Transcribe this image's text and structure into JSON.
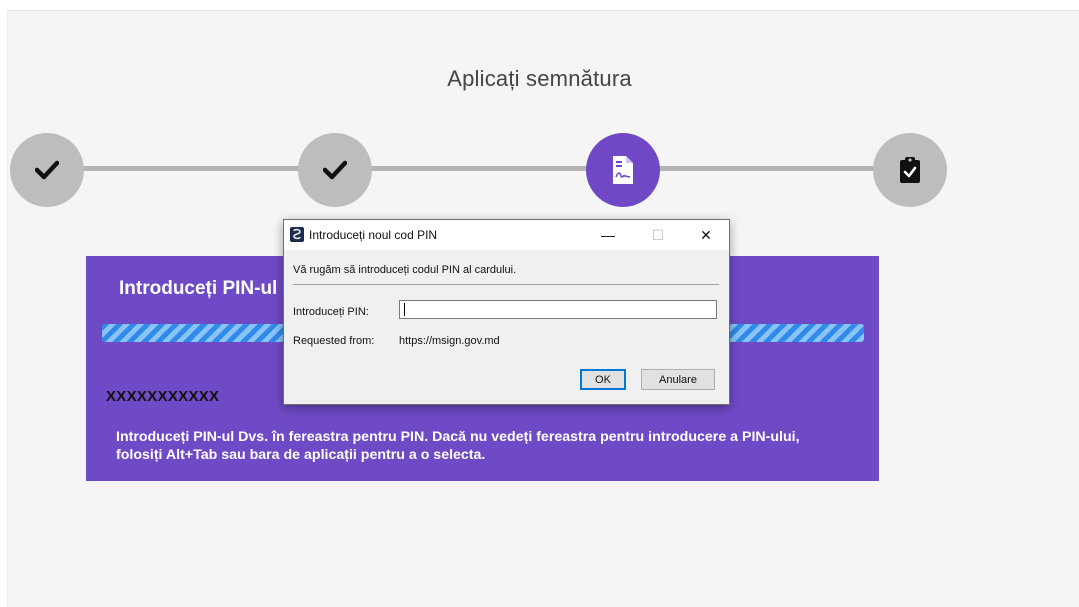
{
  "page": {
    "title": "Aplicați semnătura"
  },
  "stepper": {
    "steps": [
      {
        "state": "completed",
        "icon": "check-icon"
      },
      {
        "state": "completed",
        "icon": "check-icon"
      },
      {
        "state": "active",
        "icon": "signed-document-icon"
      },
      {
        "state": "pending",
        "icon": "clipboard-check-icon"
      }
    ],
    "colors": {
      "completed": "#bdbdbd",
      "active": "#7048c5",
      "line": "#b4b4b4"
    }
  },
  "panel": {
    "heading": "Introduceți PIN-ul",
    "masked_id": "XXXXXXXXXXX",
    "hint": "Introduceți PIN-ul Dvs. în fereastra pentru PIN. Dacă nu vedeți fereastra pentru introducere a PIN-ului, folosiți Alt+Tab sau bara de aplicații pentru a o selecta.",
    "background": "#6f4ac6"
  },
  "dialog": {
    "title": "Introduceți noul cod PIN",
    "minimize": "—",
    "maximize": "☐",
    "close": "✕",
    "instruction": "Vă rugăm să introduceți codul PIN al cardului.",
    "pin_label": "Introduceți PIN:",
    "pin_value": "",
    "requested_label": "Requested from:",
    "requested_value": "https://msign.gov.md",
    "ok_label": "OK",
    "cancel_label": "Anulare"
  }
}
